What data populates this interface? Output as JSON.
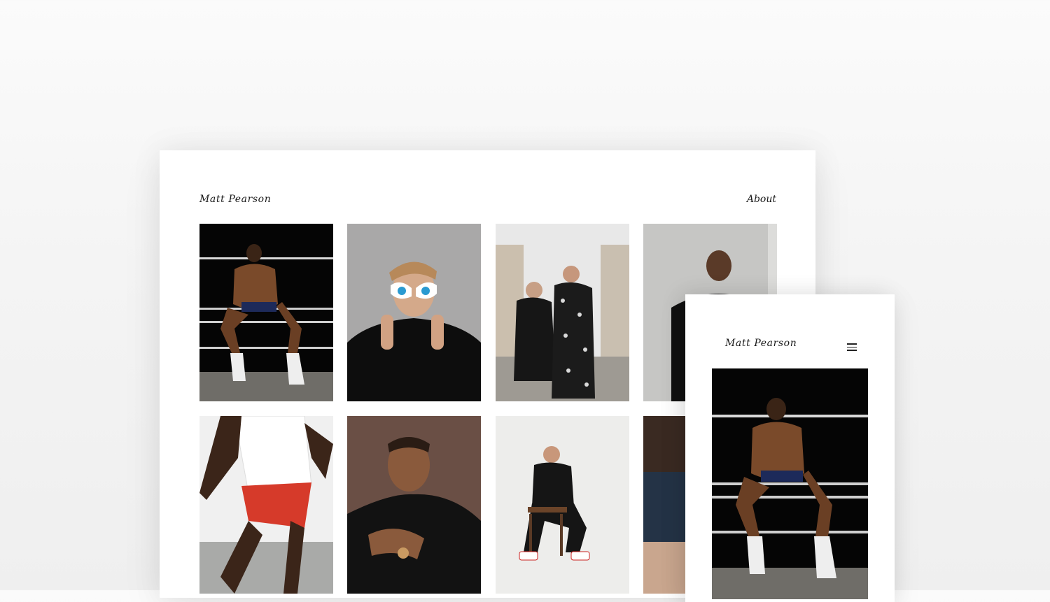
{
  "desktop": {
    "logo_text": "Matt Pearson",
    "nav_about": "About"
  },
  "mobile": {
    "logo_text": "Matt Pearson",
    "menu_icon": "hamburger-icon"
  },
  "gallery": {
    "photos": [
      "boxer seated in ring ropes",
      "man in novelty sunglasses",
      "couple in paisley outfits on street",
      "man against concrete wall",
      "athlete sprinting",
      "man in black t-shirt with watch",
      "man seated on chair in black tracksuit",
      "partially visible portrait"
    ]
  }
}
